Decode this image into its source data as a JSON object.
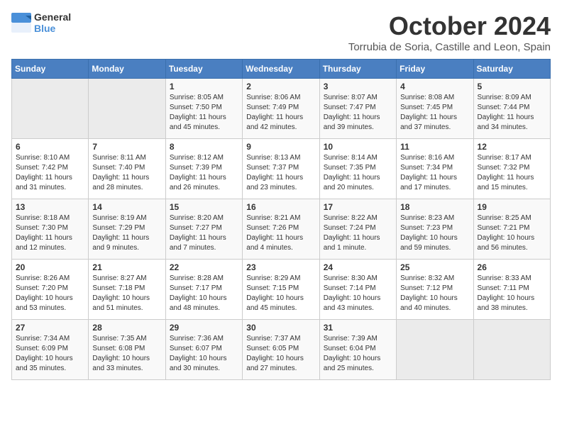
{
  "header": {
    "logo_line1": "General",
    "logo_line2": "Blue",
    "month_title": "October 2024",
    "location": "Torrubia de Soria, Castille and Leon, Spain"
  },
  "weekdays": [
    "Sunday",
    "Monday",
    "Tuesday",
    "Wednesday",
    "Thursday",
    "Friday",
    "Saturday"
  ],
  "weeks": [
    [
      {
        "day": "",
        "info": ""
      },
      {
        "day": "",
        "info": ""
      },
      {
        "day": "1",
        "info": "Sunrise: 8:05 AM\nSunset: 7:50 PM\nDaylight: 11 hours and 45 minutes."
      },
      {
        "day": "2",
        "info": "Sunrise: 8:06 AM\nSunset: 7:49 PM\nDaylight: 11 hours and 42 minutes."
      },
      {
        "day": "3",
        "info": "Sunrise: 8:07 AM\nSunset: 7:47 PM\nDaylight: 11 hours and 39 minutes."
      },
      {
        "day": "4",
        "info": "Sunrise: 8:08 AM\nSunset: 7:45 PM\nDaylight: 11 hours and 37 minutes."
      },
      {
        "day": "5",
        "info": "Sunrise: 8:09 AM\nSunset: 7:44 PM\nDaylight: 11 hours and 34 minutes."
      }
    ],
    [
      {
        "day": "6",
        "info": "Sunrise: 8:10 AM\nSunset: 7:42 PM\nDaylight: 11 hours and 31 minutes."
      },
      {
        "day": "7",
        "info": "Sunrise: 8:11 AM\nSunset: 7:40 PM\nDaylight: 11 hours and 28 minutes."
      },
      {
        "day": "8",
        "info": "Sunrise: 8:12 AM\nSunset: 7:39 PM\nDaylight: 11 hours and 26 minutes."
      },
      {
        "day": "9",
        "info": "Sunrise: 8:13 AM\nSunset: 7:37 PM\nDaylight: 11 hours and 23 minutes."
      },
      {
        "day": "10",
        "info": "Sunrise: 8:14 AM\nSunset: 7:35 PM\nDaylight: 11 hours and 20 minutes."
      },
      {
        "day": "11",
        "info": "Sunrise: 8:16 AM\nSunset: 7:34 PM\nDaylight: 11 hours and 17 minutes."
      },
      {
        "day": "12",
        "info": "Sunrise: 8:17 AM\nSunset: 7:32 PM\nDaylight: 11 hours and 15 minutes."
      }
    ],
    [
      {
        "day": "13",
        "info": "Sunrise: 8:18 AM\nSunset: 7:30 PM\nDaylight: 11 hours and 12 minutes."
      },
      {
        "day": "14",
        "info": "Sunrise: 8:19 AM\nSunset: 7:29 PM\nDaylight: 11 hours and 9 minutes."
      },
      {
        "day": "15",
        "info": "Sunrise: 8:20 AM\nSunset: 7:27 PM\nDaylight: 11 hours and 7 minutes."
      },
      {
        "day": "16",
        "info": "Sunrise: 8:21 AM\nSunset: 7:26 PM\nDaylight: 11 hours and 4 minutes."
      },
      {
        "day": "17",
        "info": "Sunrise: 8:22 AM\nSunset: 7:24 PM\nDaylight: 11 hours and 1 minute."
      },
      {
        "day": "18",
        "info": "Sunrise: 8:23 AM\nSunset: 7:23 PM\nDaylight: 10 hours and 59 minutes."
      },
      {
        "day": "19",
        "info": "Sunrise: 8:25 AM\nSunset: 7:21 PM\nDaylight: 10 hours and 56 minutes."
      }
    ],
    [
      {
        "day": "20",
        "info": "Sunrise: 8:26 AM\nSunset: 7:20 PM\nDaylight: 10 hours and 53 minutes."
      },
      {
        "day": "21",
        "info": "Sunrise: 8:27 AM\nSunset: 7:18 PM\nDaylight: 10 hours and 51 minutes."
      },
      {
        "day": "22",
        "info": "Sunrise: 8:28 AM\nSunset: 7:17 PM\nDaylight: 10 hours and 48 minutes."
      },
      {
        "day": "23",
        "info": "Sunrise: 8:29 AM\nSunset: 7:15 PM\nDaylight: 10 hours and 45 minutes."
      },
      {
        "day": "24",
        "info": "Sunrise: 8:30 AM\nSunset: 7:14 PM\nDaylight: 10 hours and 43 minutes."
      },
      {
        "day": "25",
        "info": "Sunrise: 8:32 AM\nSunset: 7:12 PM\nDaylight: 10 hours and 40 minutes."
      },
      {
        "day": "26",
        "info": "Sunrise: 8:33 AM\nSunset: 7:11 PM\nDaylight: 10 hours and 38 minutes."
      }
    ],
    [
      {
        "day": "27",
        "info": "Sunrise: 7:34 AM\nSunset: 6:09 PM\nDaylight: 10 hours and 35 minutes."
      },
      {
        "day": "28",
        "info": "Sunrise: 7:35 AM\nSunset: 6:08 PM\nDaylight: 10 hours and 33 minutes."
      },
      {
        "day": "29",
        "info": "Sunrise: 7:36 AM\nSunset: 6:07 PM\nDaylight: 10 hours and 30 minutes."
      },
      {
        "day": "30",
        "info": "Sunrise: 7:37 AM\nSunset: 6:05 PM\nDaylight: 10 hours and 27 minutes."
      },
      {
        "day": "31",
        "info": "Sunrise: 7:39 AM\nSunset: 6:04 PM\nDaylight: 10 hours and 25 minutes."
      },
      {
        "day": "",
        "info": ""
      },
      {
        "day": "",
        "info": ""
      }
    ]
  ]
}
